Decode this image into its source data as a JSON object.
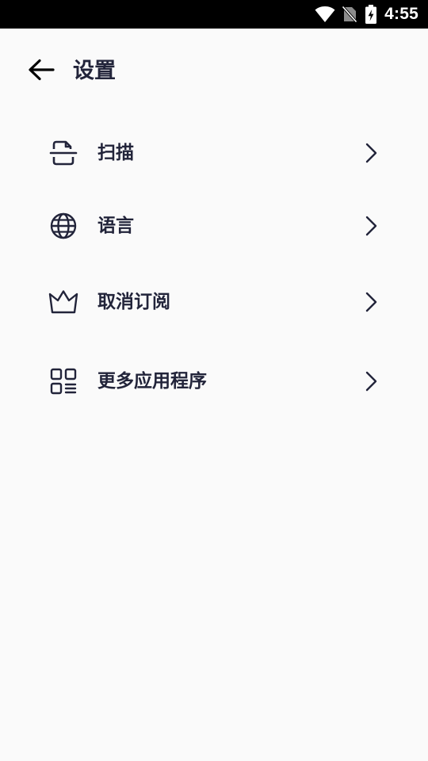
{
  "status_bar": {
    "time": "4:55",
    "icons": [
      "wifi-icon",
      "no-sim-icon",
      "battery-charging-icon"
    ]
  },
  "header": {
    "title": "设置",
    "back_icon": "arrow-left-icon"
  },
  "settings": {
    "items": [
      {
        "label": "扫描",
        "icon": "scan-icon",
        "chevron": "chevron-right-icon"
      },
      {
        "label": "语言",
        "icon": "globe-icon",
        "chevron": "chevron-right-icon"
      },
      {
        "label": "取消订阅",
        "icon": "crown-icon",
        "chevron": "chevron-right-icon"
      },
      {
        "label": "更多应用程序",
        "icon": "apps-grid-icon",
        "chevron": "chevron-right-icon"
      }
    ]
  },
  "colors": {
    "background": "#fafafa",
    "status_bar": "#000000",
    "text_primary": "#22243a"
  }
}
